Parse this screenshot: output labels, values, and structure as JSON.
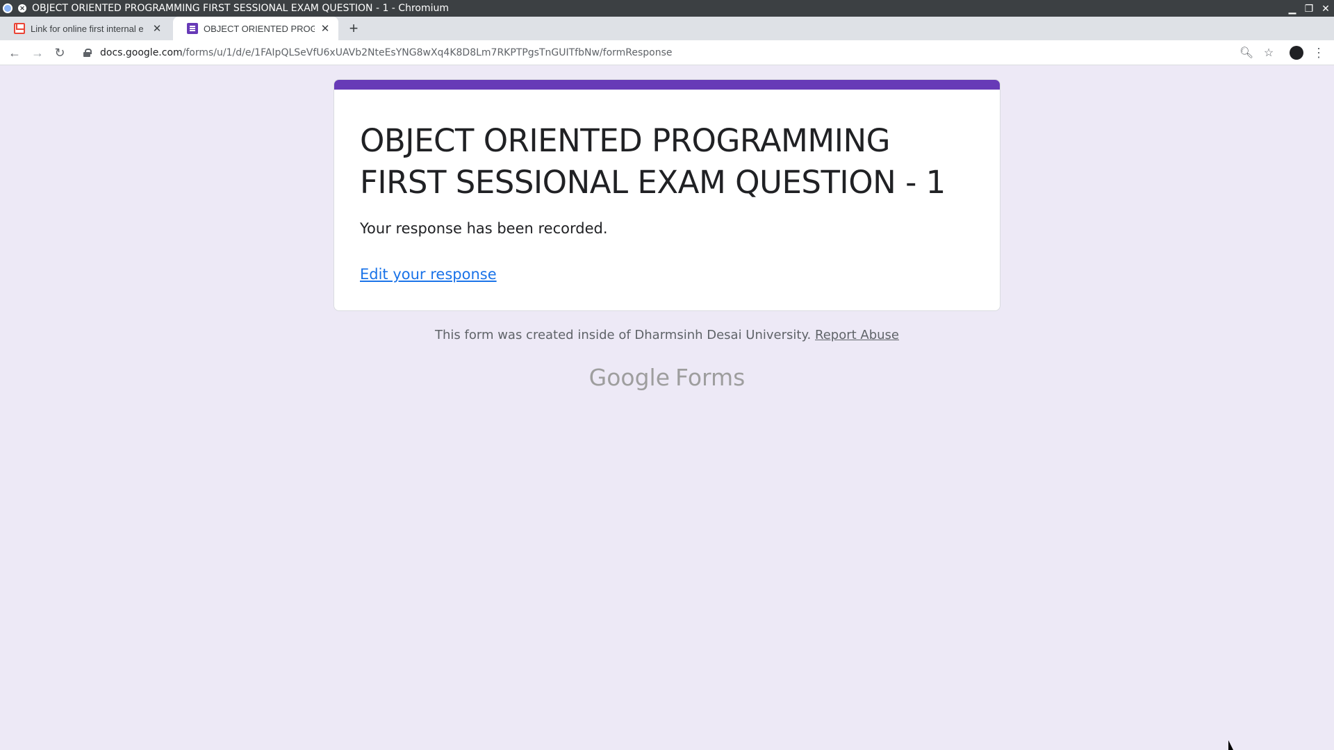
{
  "window": {
    "title": "OBJECT ORIENTED PROGRAMMING FIRST SESSIONAL EXAM QUESTION - 1 - Chromium"
  },
  "tabs": [
    {
      "label": "Link for online first internal e",
      "icon": "gmail-icon",
      "active": false
    },
    {
      "label": "OBJECT ORIENTED PROGRAM",
      "icon": "forms-icon",
      "active": true
    }
  ],
  "address_bar": {
    "host": "docs.google.com",
    "path": "/forms/u/1/d/e/1FAIpQLSeVfU6xUAVb2NteEsYNG8wXq4K8D8Lm7RKPTPgsTnGUITfbNw/formResponse"
  },
  "form": {
    "accent_color": "#673ab7",
    "title": "OBJECT ORIENTED PROGRAMMING FIRST SESSIONAL EXAM QUESTION - 1",
    "confirmation": "Your response has been recorded.",
    "edit_link": "Edit your response"
  },
  "footer": {
    "text": "This form was created inside of Dharmsinh Desai University.",
    "report_link": "Report Abuse",
    "brand_google": "Google",
    "brand_forms": "Forms"
  }
}
